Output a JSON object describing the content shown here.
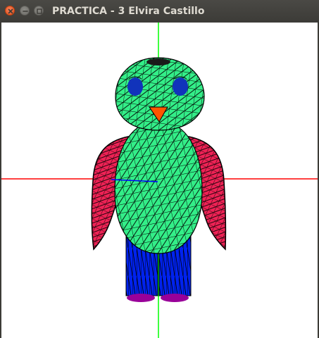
{
  "window": {
    "title": "PRACTICA - 3 Elvira Castillo"
  },
  "controls": {
    "close_icon": "close-icon",
    "minimize_icon": "minimize-icon",
    "maximize_icon": "maximize-icon"
  },
  "scene": {
    "background": "#ffffff",
    "x_axis_color": "#ff0000",
    "y_axis_color": "#00ff00",
    "z_axis_color": "#0000ff",
    "colors": {
      "body": "#33ee88",
      "wings": "#ee2255",
      "legs": "#0022ee",
      "feet": "#990099",
      "beak": "#ff5500",
      "eyes": "#1133bb",
      "wire": "#000000"
    }
  }
}
